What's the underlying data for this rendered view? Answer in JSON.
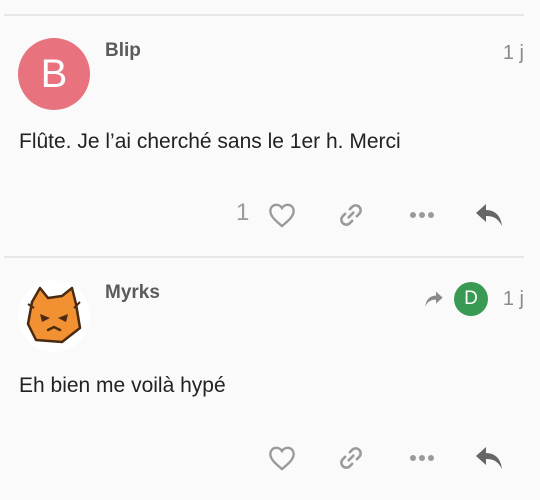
{
  "posts": [
    {
      "username": "Blip",
      "avatar_letter": "B",
      "avatar_color": "#e8727d",
      "age": "1 j",
      "content": "Flûte. Je l’ai cherché sans le 1er h. Merci",
      "like_count": "1"
    },
    {
      "username": "Myrks",
      "avatar_icon": "orange-cat-mascot-icon",
      "reply_to_avatar_letter": "D",
      "reply_to_avatar_color": "#3a9a54",
      "age": "1 j",
      "content": "Eh bien me voilà hypé"
    }
  ],
  "icons": {
    "like": "heart-icon",
    "link": "link-icon",
    "more": "more-icon",
    "reply": "reply-icon",
    "reply_to": "reply-to-arrow-icon"
  },
  "colors": {
    "background": "#fafafa",
    "divider": "#e6e6e6",
    "icon": "#9a9a9a",
    "reply_icon": "#666666"
  }
}
